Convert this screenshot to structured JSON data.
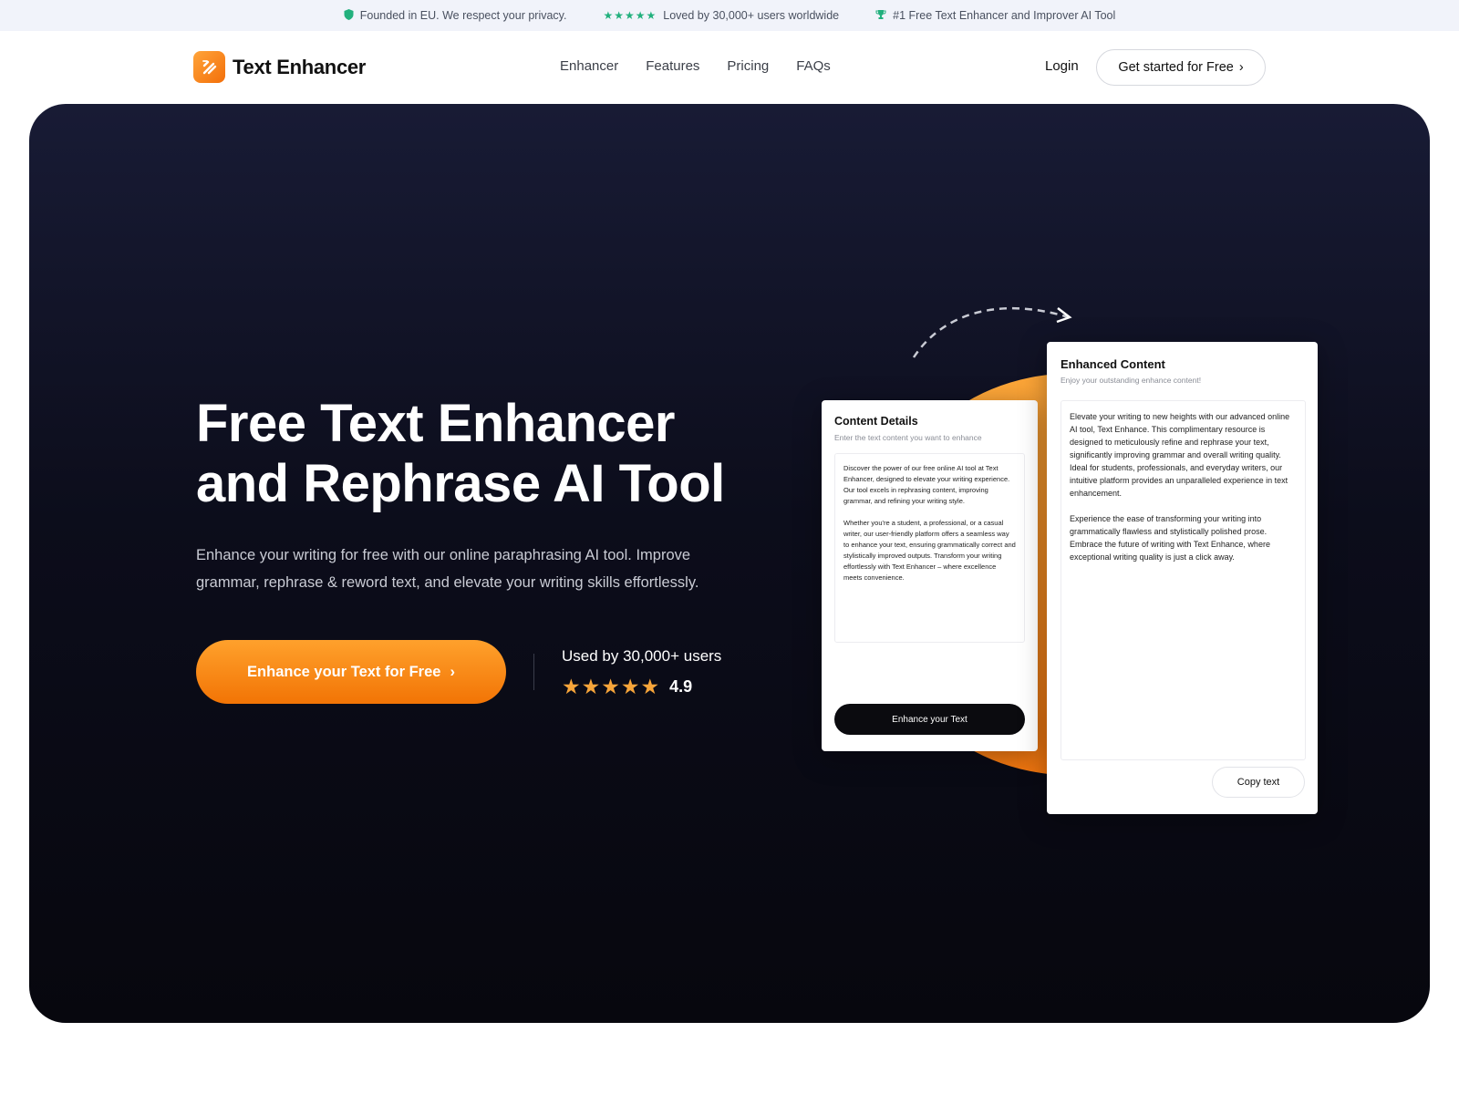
{
  "topbar": {
    "privacy": "Founded in EU. We respect your privacy.",
    "stars": "★★★★★",
    "loved": "Loved by 30,000+ users worldwide",
    "award": "#1 Free Text Enhancer and Improver AI Tool"
  },
  "header": {
    "logo_text": "Text Enhancer",
    "nav": [
      "Enhancer",
      "Features",
      "Pricing",
      "FAQs"
    ],
    "login": "Login",
    "cta": "Get started for Free",
    "cta_chevron": "›"
  },
  "hero": {
    "title": "Free Text Enhancer and Rephrase AI Tool",
    "subtitle": "Enhance your writing for free with our online paraphrasing AI tool. Improve grammar, rephrase & reword text, and elevate your writing skills effortlessly.",
    "button": "Enhance your Text for Free",
    "button_chevron": "›",
    "used_by": "Used by 30,000+ users",
    "rating_stars": "★★★★★",
    "rating": "4.9"
  },
  "input_card": {
    "title": "Content Details",
    "hint": "Enter the text content you want to enhance",
    "paragraphs": [
      "Discover the power of our free online AI tool at Text Enhancer, designed to elevate your writing experience. Our tool excels in rephrasing content, improving grammar, and refining your writing style.",
      "Whether you're a student, a professional, or a casual writer, our user-friendly platform offers a seamless way to enhance your text, ensuring grammatically correct and stylistically improved outputs. Transform your writing effortlessly with Text Enhancer – where excellence meets convenience."
    ],
    "button": "Enhance your Text"
  },
  "output_card": {
    "title": "Enhanced Content",
    "hint": "Enjoy your outstanding enhance content!",
    "paragraphs": [
      "Elevate your writing to new heights with our advanced online AI tool, Text Enhance. This complimentary resource is designed to meticulously refine and rephrase your text, significantly improving grammar and overall writing quality. Ideal for students, professionals, and everyday writers, our intuitive platform provides an unparalleled experience in text enhancement.",
      "Experience the ease of transforming your writing into grammatically flawless and stylistically polished prose. Embrace the future of writing with Text Enhance, where exceptional writing quality is just a click away."
    ],
    "copy": "Copy text"
  },
  "colors": {
    "accent": "#f57f0f",
    "hero_bg": "#0c0d1b",
    "trust_green": "#22b07d",
    "star": "#f7a53a"
  }
}
